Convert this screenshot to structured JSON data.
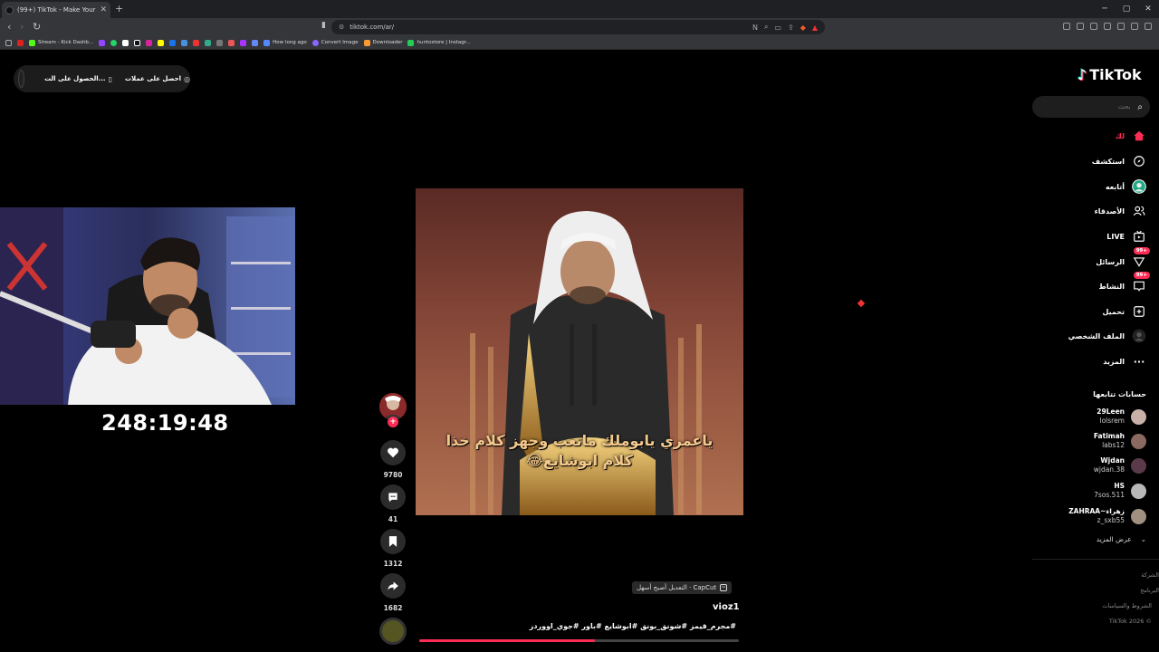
{
  "browser": {
    "tab_title": "(99+) TikTok - Make Your Day",
    "url": "tiktok.com/ar/",
    "bookmarks": [
      "Stream - Kick Dashb...",
      "How long ago",
      "Convert Image",
      "Downloader",
      "huntostore | Instagr..."
    ]
  },
  "header_pill": {
    "get_coins": "احصل على عملات",
    "get_app": "الحصول على الت..."
  },
  "stream": {
    "timer": "248:19:48"
  },
  "video": {
    "caption_line1": "ياعمري يابوملك ماتعب وجهز كلام خذا",
    "caption_line2": "كلام ابوشايع😂",
    "likes": "9780",
    "comments": "41",
    "saves": "1312",
    "shares": "1682",
    "capcut_label": "CapCut · التعديل أصبح أسهل",
    "author": "vioz1",
    "hashtags": "#مجرم_قيمز #شونق_بونق #ابوشايع #باور #جوي_اووردز",
    "progress": 0.55
  },
  "sidebar": {
    "logo": "TikTok",
    "search_placeholder": "بحث",
    "menu": {
      "home": "لك",
      "explore": "استكشف",
      "following": "أتابعه",
      "friends": "الأصدقاء",
      "live": "LIVE",
      "messages": "الرسائل",
      "activity": "النشاط",
      "upload": "تحميل",
      "profile": "الملف الشخصي",
      "more": "المزيد"
    },
    "badges": {
      "messages": "99+",
      "activity": "99+"
    },
    "following_title": "حسابات تتابعها",
    "accounts": [
      {
        "name": "29Leen",
        "handle": "lolsrem"
      },
      {
        "name": "Fatimah",
        "handle": "labs12"
      },
      {
        "name": "Wjdan",
        "handle": "wjdan.38"
      },
      {
        "name": "HS",
        "handle": "7sos.511"
      },
      {
        "name": "ZAHRAA~زهراء",
        "handle": "z_sxb55"
      }
    ],
    "see_more": "عرض المزيد",
    "footer": [
      "الشركة",
      "البرنامج",
      "الشروط والسياسات",
      "TikTok 2026 ©"
    ]
  }
}
